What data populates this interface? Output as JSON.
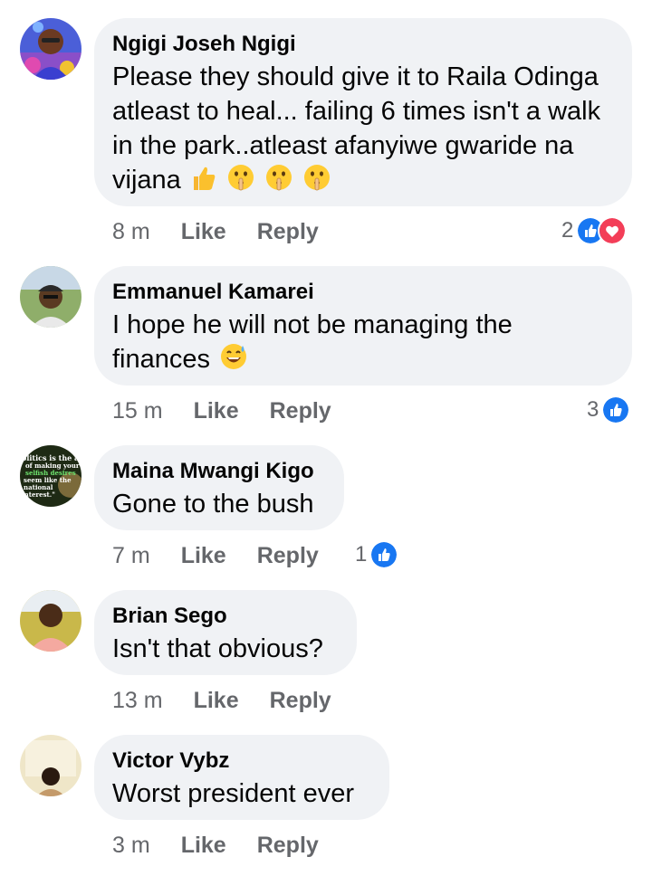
{
  "comments": [
    {
      "author": "Ngigi Joseh Ngigi",
      "text": "Please they should give it to Raila Odinga atleast to heal... failing 6 times isn't a walk in the park..atleast afanyiwe gwaride na vijana",
      "time": "8 m",
      "like": "Like",
      "reply": "Reply",
      "reaction_count": "2",
      "reactions": [
        "like-icon",
        "love-icon"
      ],
      "emojis": [
        "thumbs-up-icon",
        "shushing-face-icon",
        "shushing-face-icon",
        "shushing-face-icon"
      ]
    },
    {
      "author": "Emmanuel Kamarei",
      "text": "I hope he will not be managing the finances",
      "time": "15 m",
      "like": "Like",
      "reply": "Reply",
      "reaction_count": "3",
      "reactions": [
        "like-icon"
      ],
      "emojis": [
        "sweat-smile-icon"
      ]
    },
    {
      "author": "Maina Mwangi Kigo",
      "text": "Gone to the bush",
      "time": "7 m",
      "like": "Like",
      "reply": "Reply",
      "reaction_count": "1",
      "reactions": [
        "like-icon"
      ],
      "avatar_text": [
        "olitics is the ar",
        "of making your",
        "selfish desires",
        "seem like the",
        "national",
        "interest.\""
      ]
    },
    {
      "author": "Brian Sego",
      "text": "Isn't that obvious?",
      "time": "13 m",
      "like": "Like",
      "reply": "Reply"
    },
    {
      "author": "Victor Vybz",
      "text": "Worst president ever",
      "time": "3 m",
      "like": "Like",
      "reply": "Reply"
    }
  ],
  "colors": {
    "bubble": "#f0f2f5",
    "meta": "#65676b",
    "like_blue": "#1877f2",
    "love_red": "#f33e58"
  }
}
